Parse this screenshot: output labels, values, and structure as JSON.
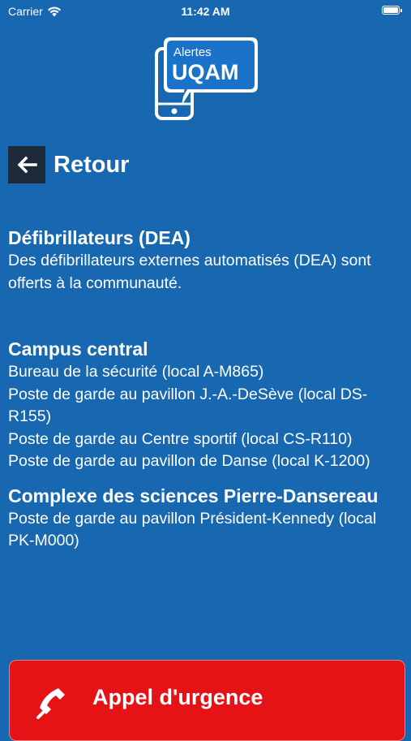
{
  "status_bar": {
    "carrier": "Carrier",
    "time": "11:42 AM"
  },
  "logo": {
    "line1": "Alertes",
    "line2": "UQAM"
  },
  "nav": {
    "back_label": "Retour"
  },
  "sections": [
    {
      "title": "Défibrillateurs (DEA)",
      "lines": [
        "Des défibrillateurs externes automatisés (DEA) sont offerts à la communauté."
      ]
    },
    {
      "title": "Campus central",
      "lines": [
        "Bureau de la sécurité (local A-M865)",
        "Poste de garde au pavillon J.-A.-DeSève (local DS-R155)",
        "Poste de garde au Centre sportif (local CS-R110)",
        "Poste de garde au pavillon de Danse (local K-1200)"
      ]
    },
    {
      "title": "Complexe des sciences Pierre-Dansereau",
      "lines": [
        "Poste de garde au pavillon Président-Kennedy (local PK-M000)"
      ]
    }
  ],
  "emergency": {
    "label": "Appel d'urgence"
  },
  "colors": {
    "background": "#1767b1",
    "emergency": "#e51315",
    "back_box": "#1c2a3c"
  }
}
